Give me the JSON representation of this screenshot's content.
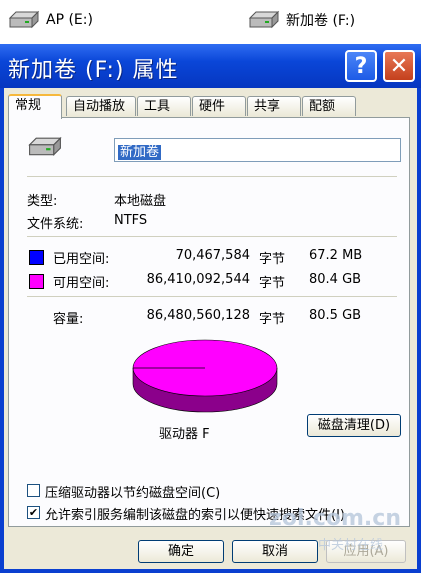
{
  "desktop": {
    "drives": [
      {
        "label": "AP (E:)"
      },
      {
        "label": "新加卷 (F:)"
      }
    ]
  },
  "window": {
    "title": "新加卷 (F:) 属性",
    "help_label": "?",
    "close_label": "✕"
  },
  "tabs": [
    "常规",
    "自动播放",
    "工具",
    "硬件",
    "共享",
    "配额"
  ],
  "general": {
    "volume_name": "新加卷",
    "type_label": "类型:",
    "type_value": "本地磁盘",
    "fs_label": "文件系统:",
    "fs_value": "NTFS",
    "used": {
      "label": "已用空间:",
      "bytes": "70,467,584",
      "unit": "字节",
      "size": "67.2 MB",
      "color": "#0000ff"
    },
    "free": {
      "label": "可用空间:",
      "bytes": "86,410,092,544",
      "unit": "字节",
      "size": "80.4 GB",
      "color": "#ff00ff"
    },
    "capacity": {
      "label": "容量:",
      "bytes": "86,480,560,128",
      "unit": "字节",
      "size": "80.5 GB"
    },
    "used_fraction": 0.0008,
    "drive_label": "驱动器 F",
    "cleanup_button": "磁盘清理(D)",
    "compress_checkbox": "压缩驱动器以节约磁盘空间(C)",
    "compress_checked": false,
    "index_checkbox": "允许索引服务编制该磁盘的索引以便快速搜索文件(I)",
    "index_checked": true
  },
  "buttons": {
    "ok": "确定",
    "cancel": "取消",
    "apply": "应用(A)"
  },
  "watermark": {
    "main": "zol.com.cn",
    "sub": "中关村在线"
  }
}
